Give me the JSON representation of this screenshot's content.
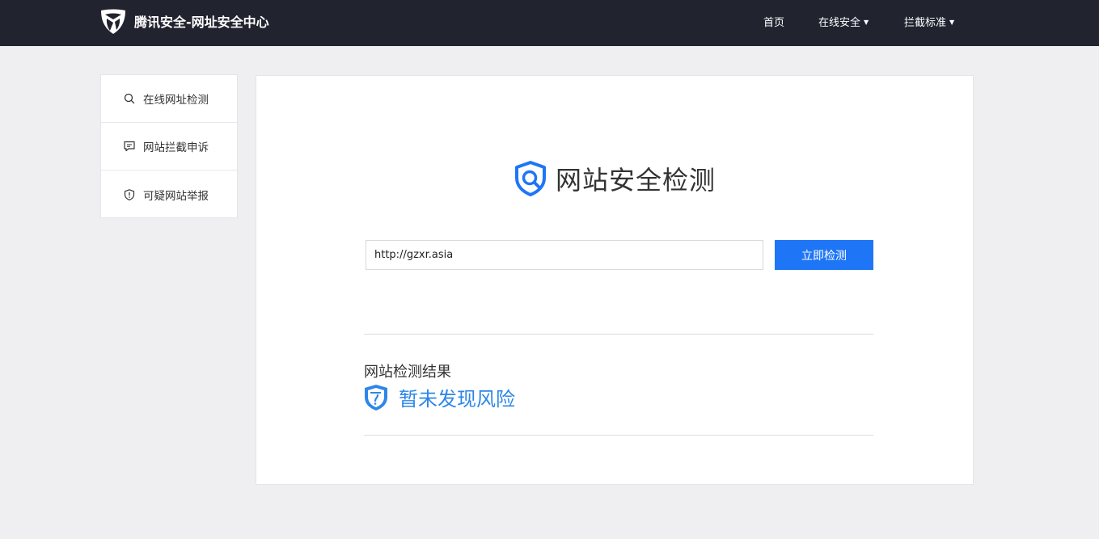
{
  "header": {
    "brand_title": "腾讯安全-网址安全中心",
    "nav": [
      {
        "label": "首页",
        "has_dropdown": false
      },
      {
        "label": "在线安全",
        "has_dropdown": true
      },
      {
        "label": "拦截标准",
        "has_dropdown": true
      }
    ],
    "caret": "▼"
  },
  "sidebar": {
    "items": [
      {
        "label": "在线网址检测",
        "icon": "search-icon"
      },
      {
        "label": "网站拦截申诉",
        "icon": "chat-icon"
      },
      {
        "label": "可疑网站举报",
        "icon": "shield-alert-icon"
      }
    ]
  },
  "main": {
    "title": "网站安全检测",
    "url_input_value": "http://gzxr.asia",
    "check_button_label": "立即检测",
    "result_heading": "网站检测结果",
    "result_text": "暂未发现风险"
  },
  "colors": {
    "topbar": "#21232f",
    "accent_blue": "#1e76f7",
    "result_blue": "#2d86e8",
    "page_bg": "#efeff2"
  }
}
